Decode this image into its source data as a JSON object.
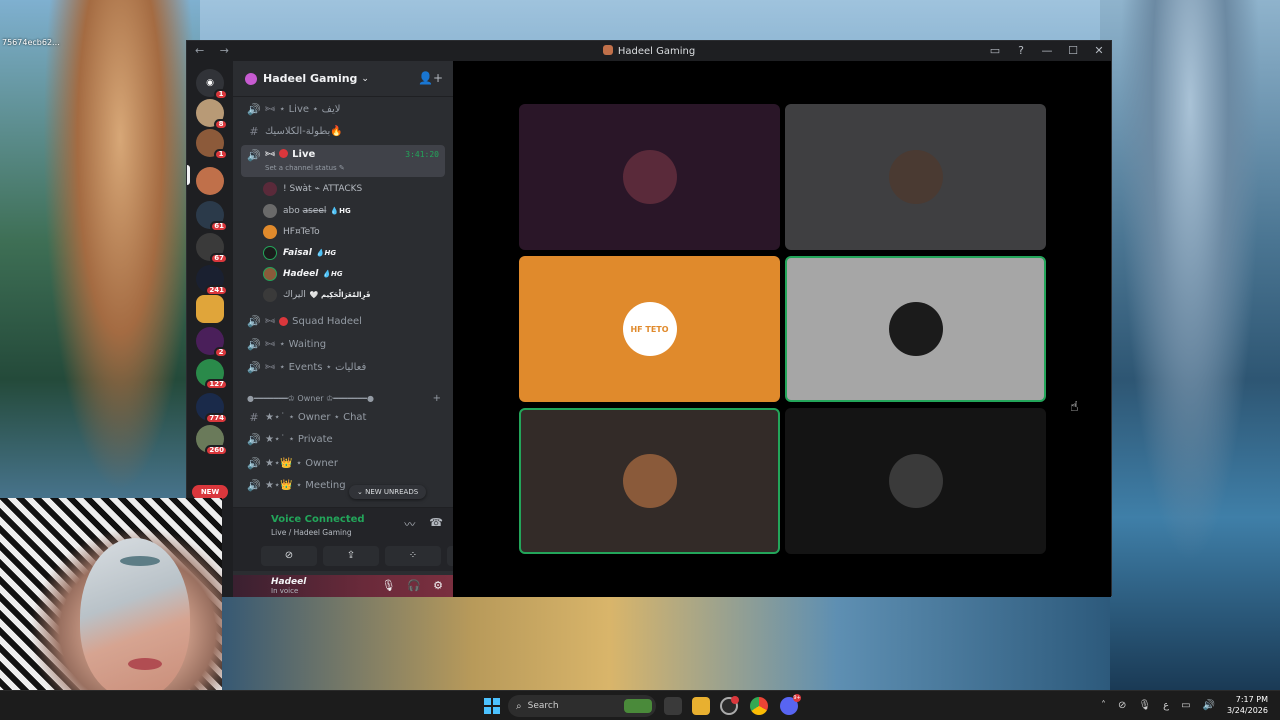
{
  "desktop": {
    "label": "75674ecb62..."
  },
  "window": {
    "title": "Hadeel Gaming",
    "nav": "← →",
    "controls": [
      "▭",
      "?",
      "—",
      "☐",
      "✕"
    ]
  },
  "rail": {
    "badges": [
      "1",
      "8",
      "1",
      "61",
      "67",
      "241",
      "2",
      "127",
      "774",
      "260"
    ],
    "new_label": "NEW"
  },
  "sidebar": {
    "server_name": "Hadeel Gaming",
    "channels_top": [
      {
        "icon": "🔊",
        "label": "⋆ Live ⋆ لايف"
      },
      {
        "icon": "#",
        "label": "بطولة-الكلاسيك🔥"
      }
    ],
    "active_channel": {
      "label": "Live",
      "timer": "3:41:20",
      "status": "Set a channel status ✎"
    },
    "members": [
      {
        "name": "! Swàt ⌁ ATTACKS",
        "tag": ""
      },
      {
        "name": "abo a̶s̶e̶e̶l̶",
        "tag": "💧HG"
      },
      {
        "name": "HF¤TeTo",
        "tag": ""
      },
      {
        "name": "Faisal",
        "tag": "💧HG"
      },
      {
        "name": "Hadeel",
        "tag": "💧HG"
      },
      {
        "name": "اليراك",
        "tag": "🤍 قَرِالمُغَرَالْحَكِيم"
      }
    ],
    "channels_bottom": [
      {
        "icon": "🔊",
        "label": "Squad Hadeel"
      },
      {
        "icon": "🔊",
        "label": "⋆ Waiting"
      },
      {
        "icon": "🔊",
        "label": "⋆ Events ⋆ فعاليات"
      }
    ],
    "category": "●━━━━━━━♔ Owner ♔━━━━━━━●",
    "owner_channels": [
      {
        "icon": "#",
        "label": "★⋆˙ ⋆ Owner ⋆ Chat"
      },
      {
        "icon": "🔊",
        "label": "★⋆˙ ⋆ Private"
      },
      {
        "icon": "🔊",
        "label": "★⋆👑 ⋆ Owner"
      },
      {
        "icon": "🔊",
        "label": "★⋆👑 ⋆ Meeting"
      }
    ],
    "new_unreads": "⌄ NEW UNREADS"
  },
  "voice": {
    "title": "Voice Connected",
    "channel": "Live / Hadeel Gaming",
    "icons": [
      "〰",
      "☎"
    ],
    "buttons": [
      "⊘",
      "⇪",
      "⁘",
      "✨"
    ]
  },
  "user": {
    "name": "Hadeel",
    "status": "In voice",
    "icons": [
      "🎙",
      "🎧",
      "⚙"
    ]
  },
  "tiles": [
    {
      "bg": "#2a1628",
      "av": "#5a2a3a",
      "speaking": false,
      "label": ""
    },
    {
      "bg": "#3f3f41",
      "av": "#4a3a32",
      "speaking": false,
      "label": ""
    },
    {
      "bg": "#e08a2c",
      "av": "#ffffff",
      "speaking": false,
      "label": "HF TETO"
    },
    {
      "bg": "#a6a6a6",
      "av": "#1b1b1b",
      "speaking": true,
      "label": ""
    },
    {
      "bg": "#332b28",
      "av": "#8a5a3a",
      "speaking": true,
      "label": ""
    },
    {
      "bg": "#141414",
      "av": "#3a3a3a",
      "speaking": false,
      "label": ""
    }
  ],
  "taskbar": {
    "search_placeholder": "Search",
    "time": "7:17 PM",
    "date": "3/24/2026",
    "lang": "ع",
    "discord_badge": "9+"
  }
}
